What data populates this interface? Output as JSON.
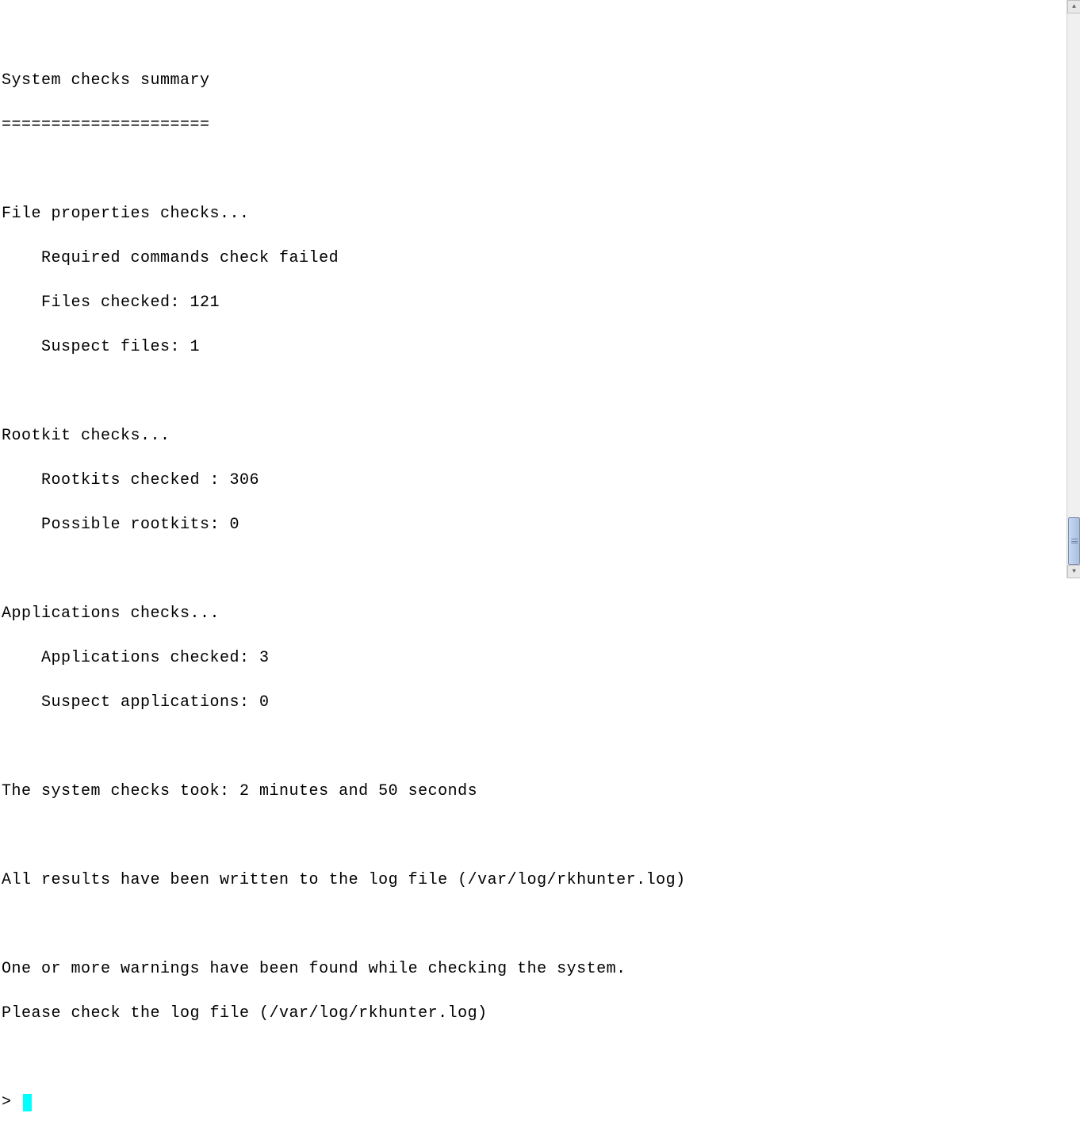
{
  "terminal": {
    "title": "System checks summary",
    "divider": "=====================",
    "sections": {
      "file_properties": {
        "header": "File properties checks...",
        "required_cmd": "    Required commands check failed",
        "files_checked": "    Files checked: 121",
        "suspect_files": "    Suspect files: 1"
      },
      "rootkit": {
        "header": "Rootkit checks...",
        "rootkits_checked": "    Rootkits checked : 306",
        "possible_rootkits": "    Possible rootkits: 0"
      },
      "applications": {
        "header": "Applications checks...",
        "apps_checked": "    Applications checked: 3",
        "suspect_apps": "    Suspect applications: 0"
      }
    },
    "duration": "The system checks took: 2 minutes and 50 seconds",
    "log_written": "All results have been written to the log file (/var/log/rkhunter.log)",
    "warning1": "One or more warnings have been found while checking the system.",
    "warning2": "Please check the log file (/var/log/rkhunter.log)",
    "prompt": "> "
  }
}
